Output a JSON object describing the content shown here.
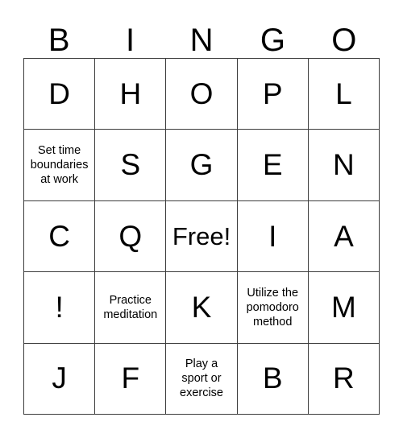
{
  "card": {
    "header_letters": [
      "B",
      "I",
      "N",
      "G",
      "O"
    ],
    "free_space_label": "Free!",
    "border_color": "#3c3c3c",
    "background_color": "#ffffff",
    "text_color": "#000000",
    "rows": [
      [
        {
          "text": "D",
          "size": "large"
        },
        {
          "text": "H",
          "size": "large"
        },
        {
          "text": "O",
          "size": "large"
        },
        {
          "text": "P",
          "size": "large"
        },
        {
          "text": "L",
          "size": "large"
        }
      ],
      [
        {
          "text": "Set time\nboundaries\nat work",
          "size": "small"
        },
        {
          "text": "S",
          "size": "large"
        },
        {
          "text": "G",
          "size": "large"
        },
        {
          "text": "E",
          "size": "large"
        },
        {
          "text": "N",
          "size": "large"
        }
      ],
      [
        {
          "text": "C",
          "size": "large"
        },
        {
          "text": "Q",
          "size": "large"
        },
        {
          "text": "Free!",
          "size": "medium"
        },
        {
          "text": "I",
          "size": "large"
        },
        {
          "text": "A",
          "size": "large"
        }
      ],
      [
        {
          "text": "!",
          "size": "large"
        },
        {
          "text": "Practice\nmeditation",
          "size": "small"
        },
        {
          "text": "K",
          "size": "large"
        },
        {
          "text": "Utilize the\npomodoro\nmethod",
          "size": "small"
        },
        {
          "text": "M",
          "size": "large"
        }
      ],
      [
        {
          "text": "J",
          "size": "large"
        },
        {
          "text": "F",
          "size": "large"
        },
        {
          "text": "Play a\nsport or\nexercise",
          "size": "small"
        },
        {
          "text": "B",
          "size": "large"
        },
        {
          "text": "R",
          "size": "large"
        }
      ]
    ]
  }
}
